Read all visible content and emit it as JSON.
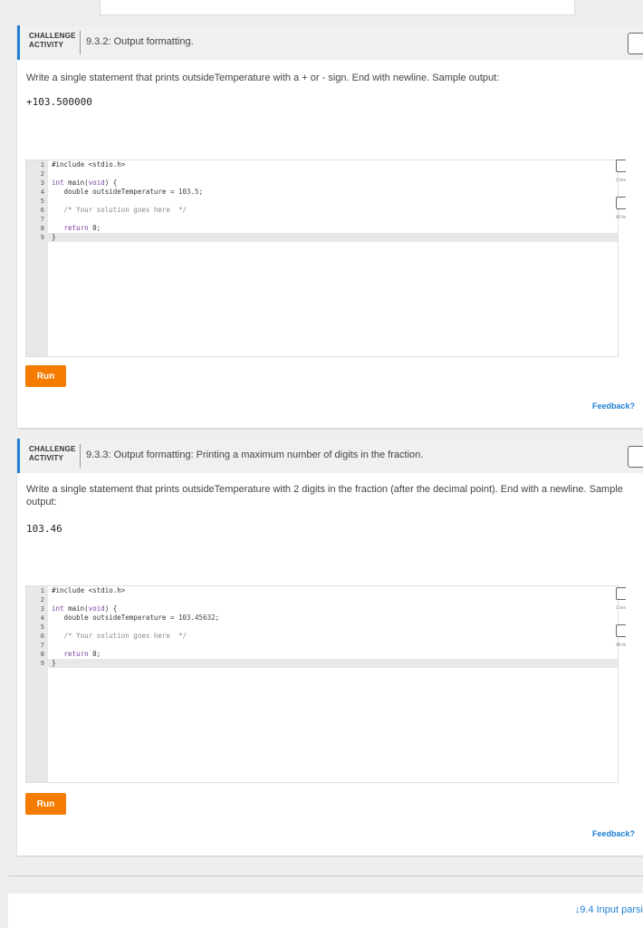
{
  "activities": [
    {
      "badge_line1": "CHALLENGE",
      "badge_line2": "ACTIVITY",
      "title": "9.3.2: Output formatting.",
      "instructions": "Write a single statement that prints outsideTemperature with a + or - sign. End with newline. Sample output:",
      "sample_output": "+103.500000",
      "line_numbers": [
        "1",
        "2",
        "3",
        "4",
        "5",
        "6",
        "7",
        "8",
        "9"
      ],
      "code": {
        "l1": "#include <stdio.h>",
        "l3a": "int ",
        "l3b": "main(",
        "l3c": "void",
        "l3d": ") {",
        "l4a": "   double outsideTemperature = ",
        "l4b": "103.5",
        "l4c": ";",
        "l6": "   /* Your solution goes here  */",
        "l8a": "   ",
        "l8b": "return",
        "l8c": " 0;",
        "l9": "}"
      },
      "run_label": "Run",
      "feedback_label": "Feedback?",
      "side1": "1 tes passe",
      "side2": "All te passe"
    },
    {
      "badge_line1": "CHALLENGE",
      "badge_line2": "ACTIVITY",
      "title": "9.3.3: Output formatting: Printing a maximum number of digits in the fraction.",
      "instructions": "Write a single statement that prints outsideTemperature with 2 digits in the fraction (after the decimal point). End with a newline. Sample output:",
      "sample_output": "103.46",
      "line_numbers": [
        "1",
        "2",
        "3",
        "4",
        "5",
        "6",
        "7",
        "8",
        "9"
      ],
      "code": {
        "l1": "#include <stdio.h>",
        "l3a": "int ",
        "l3b": "main(",
        "l3c": "void",
        "l3d": ") {",
        "l4a": "   double outsideTemperature = ",
        "l4b": "103.45632",
        "l4c": ";",
        "l6": "   /* Your solution goes here  */",
        "l8a": "   ",
        "l8b": "return",
        "l8c": " 0;",
        "l9": "}"
      },
      "run_label": "Run",
      "feedback_label": "Feedback?",
      "side1": "1 tes passe",
      "side2": "All te passe"
    }
  ],
  "next_section": {
    "arrow": "↓",
    "label": "9.4 Input parsi"
  },
  "colors": {
    "accent": "#1e7fd4",
    "run_button": "#f57c00"
  },
  "icons": [
    "bookmark-icon",
    "arrow-down-icon"
  ]
}
